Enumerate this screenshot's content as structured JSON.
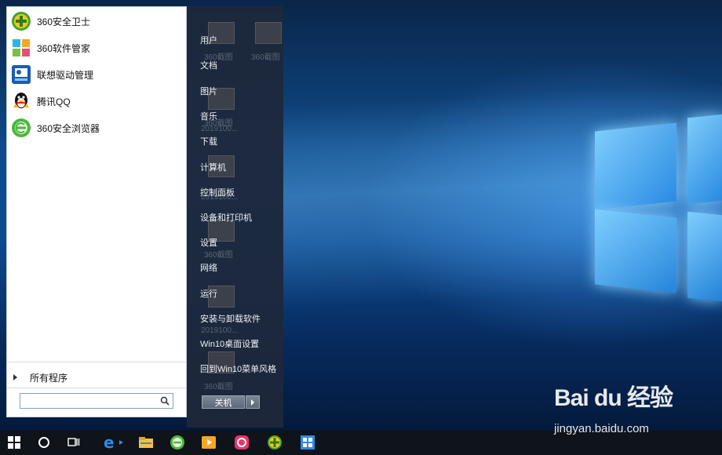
{
  "start_menu": {
    "pinned_apps": [
      {
        "label": "360安全卫士",
        "icon": "360-safe-guard-icon"
      },
      {
        "label": "360软件管家",
        "icon": "360-software-manager-icon"
      },
      {
        "label": "联想驱动管理",
        "icon": "lenovo-driver-icon"
      },
      {
        "label": "腾讯QQ",
        "icon": "qq-penguin-icon"
      },
      {
        "label": "360安全浏览器",
        "icon": "360-browser-icon"
      }
    ],
    "all_programs_label": "所有程序",
    "search_placeholder": "",
    "places": [
      "用户",
      "文档",
      "图片",
      "音乐",
      "下载",
      "计算机",
      "控制面板",
      "设备和打印机",
      "设置",
      "网络",
      "运行",
      "安装与卸载软件",
      "Win10桌面设置",
      "回到Win10菜单风格"
    ],
    "shutdown_label": "关机"
  },
  "background_ghost_labels": {
    "top": "截图",
    "name_short": "360截图",
    "name_long": "2019100..."
  },
  "taskbar": {
    "items": [
      "windows-start-icon",
      "cortana-circle-icon",
      "task-view-icon",
      "ie-browser-icon",
      "file-explorer-icon",
      "360-browser-icon",
      "video-player-icon",
      "music-app-icon",
      "360-safe-guard-icon",
      "windows-store-icon"
    ]
  },
  "watermark": {
    "logo_text": "Bai du 经验",
    "url": "jingyan.baidu.com"
  },
  "colors": {
    "accent": "#1e78d4",
    "taskbar": "#0f131a",
    "start_right_panel": "#1e283a"
  }
}
